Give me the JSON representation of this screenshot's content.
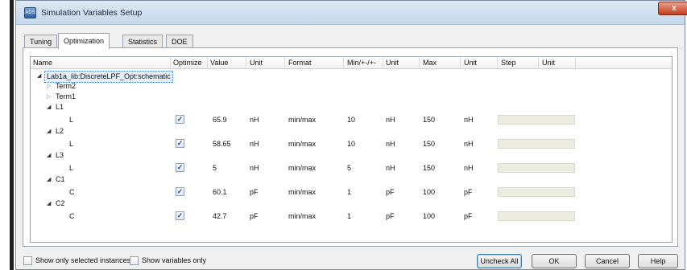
{
  "window": {
    "title": "Simulation Variables Setup",
    "app_icon_text": "ADS",
    "close_glyph": "x"
  },
  "tabs": [
    {
      "label": "Tuning",
      "active": false
    },
    {
      "label": "Optimization",
      "active": true
    },
    {
      "label": "Statistics",
      "active": false
    },
    {
      "label": "DOE",
      "active": false
    }
  ],
  "table": {
    "headers": {
      "name": "Name",
      "optimize": "Optimize",
      "value": "Value",
      "unit": "Unit",
      "format": "Format",
      "min": "Min/+-/+-",
      "min_unit": "Unit",
      "max": "Max",
      "max_unit": "Unit",
      "step": "Step",
      "step_unit": "Unit"
    },
    "root": "Lab1a_lib:DiscreteLPF_Opt:schematic",
    "collapsed_nodes": [
      "Term2",
      "Term1"
    ],
    "groups": [
      {
        "instance": "L1",
        "param": "L",
        "optimize": true,
        "value": "65.9",
        "unit": "nH",
        "format": "min/max",
        "min": "10",
        "min_unit": "nH",
        "max": "150",
        "max_unit": "nH"
      },
      {
        "instance": "L2",
        "param": "L",
        "optimize": true,
        "value": "58.65",
        "unit": "nH",
        "format": "min/max",
        "min": "10",
        "min_unit": "nH",
        "max": "150",
        "max_unit": "nH"
      },
      {
        "instance": "L3",
        "param": "L",
        "optimize": true,
        "value": "5",
        "unit": "nH",
        "format": "min/max",
        "min": "5",
        "min_unit": "nH",
        "max": "150",
        "max_unit": "nH"
      },
      {
        "instance": "C1",
        "param": "C",
        "optimize": true,
        "value": "60.1",
        "unit": "pF",
        "format": "min/max",
        "min": "1",
        "min_unit": "pF",
        "max": "100",
        "max_unit": "pF"
      },
      {
        "instance": "C2",
        "param": "C",
        "optimize": true,
        "value": "42.7",
        "unit": "pF",
        "format": "min/max",
        "min": "1",
        "min_unit": "pF",
        "max": "100",
        "max_unit": "pF"
      }
    ],
    "check_glyph": "✓",
    "expanded_glyph": "◢",
    "collapsed_glyph": "▷"
  },
  "footer": {
    "show_selected_label": "Show only selected instances",
    "show_variables_label": "Show variables only",
    "uncheck_all": "Uncheck All",
    "ok": "OK",
    "cancel": "Cancel",
    "help": "Help"
  },
  "colors": {
    "title_bar": "#c7d8ec",
    "close_button": "#c43b1c",
    "step_field": "#ecece0",
    "selection": "#e7f0fb"
  }
}
